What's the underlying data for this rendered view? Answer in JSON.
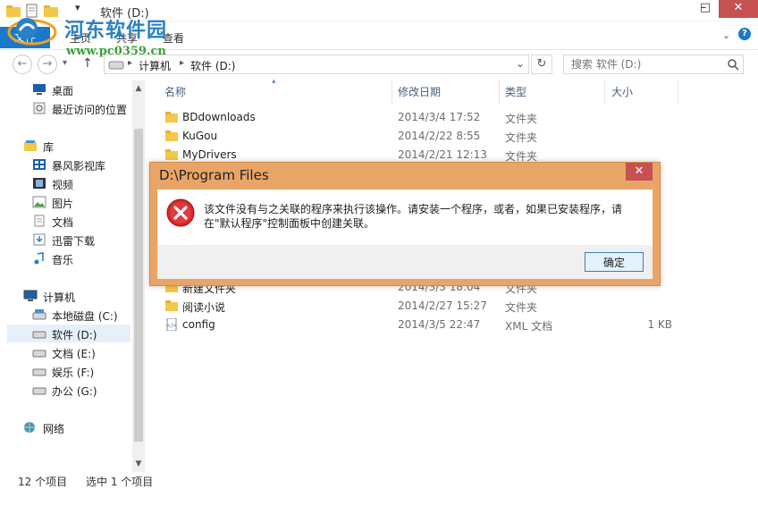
{
  "window": {
    "title": "软件 (D:)",
    "minimize": "–",
    "maximize": "□",
    "close": "✕"
  },
  "ribbon": {
    "file_tab": "文件",
    "tabs": [
      "主页",
      "共享",
      "查看"
    ]
  },
  "watermark": {
    "title": "河东软件园",
    "url": "www.pc0359.cn"
  },
  "address": {
    "crumbs": [
      "计算机",
      "软件 (D:)"
    ],
    "search_placeholder": "搜索 软件 (D:)"
  },
  "sidebar": {
    "items": [
      {
        "label": "桌面",
        "icon": "desktop-icon"
      },
      {
        "label": "最近访问的位置",
        "icon": "recent-icon"
      },
      {
        "label": "库",
        "icon": "library-icon"
      },
      {
        "label": "暴风影视库",
        "icon": "video-library-icon"
      },
      {
        "label": "视频",
        "icon": "video-icon"
      },
      {
        "label": "图片",
        "icon": "picture-icon"
      },
      {
        "label": "文档",
        "icon": "document-icon"
      },
      {
        "label": "迅雷下载",
        "icon": "download-icon"
      },
      {
        "label": "音乐",
        "icon": "music-icon"
      },
      {
        "label": "计算机",
        "icon": "computer-icon"
      },
      {
        "label": "本地磁盘 (C:)",
        "icon": "drive-icon"
      },
      {
        "label": "软件 (D:)",
        "icon": "drive-icon",
        "selected": true
      },
      {
        "label": "文档 (E:)",
        "icon": "drive-icon"
      },
      {
        "label": "娱乐 (F:)",
        "icon": "drive-icon"
      },
      {
        "label": "办公 (G:)",
        "icon": "drive-icon"
      },
      {
        "label": "网络",
        "icon": "network-icon"
      }
    ]
  },
  "columns": {
    "name": "名称",
    "date": "修改日期",
    "type": "类型",
    "size": "大小"
  },
  "files": [
    {
      "name": "BDdownloads",
      "date": "2014/3/4 17:52",
      "type": "文件夹",
      "size": "",
      "icon": "folder-icon"
    },
    {
      "name": "KuGou",
      "date": "2014/2/22 8:55",
      "type": "文件夹",
      "size": "",
      "icon": "folder-icon"
    },
    {
      "name": "MyDrivers",
      "date": "2014/2/21 12:13",
      "type": "文件夹",
      "size": "",
      "icon": "folder-icon"
    },
    {
      "name": "新建文件夹",
      "date": "2014/3/3 18:04",
      "type": "文件夹",
      "size": "",
      "icon": "folder-icon"
    },
    {
      "name": "阅读小说",
      "date": "2014/2/27 15:27",
      "type": "文件夹",
      "size": "",
      "icon": "folder-icon"
    },
    {
      "name": "config",
      "date": "2014/3/5 22:47",
      "type": "XML 文档",
      "size": "1 KB",
      "icon": "xml-file-icon"
    }
  ],
  "status": {
    "count": "12 个项目",
    "selected": "选中 1 个项目"
  },
  "dialog": {
    "title": "D:\\Program Files",
    "message": "该文件没有与之关联的程序来执行该操作。请安装一个程序，或者，如果已安装程序，请在\"默认程序\"控制面板中创建关联。",
    "ok": "确定",
    "close": "✕"
  },
  "colors": {
    "dialog_frame": "#e9a567",
    "accent": "#1979ca",
    "close_red": "#c75050"
  }
}
